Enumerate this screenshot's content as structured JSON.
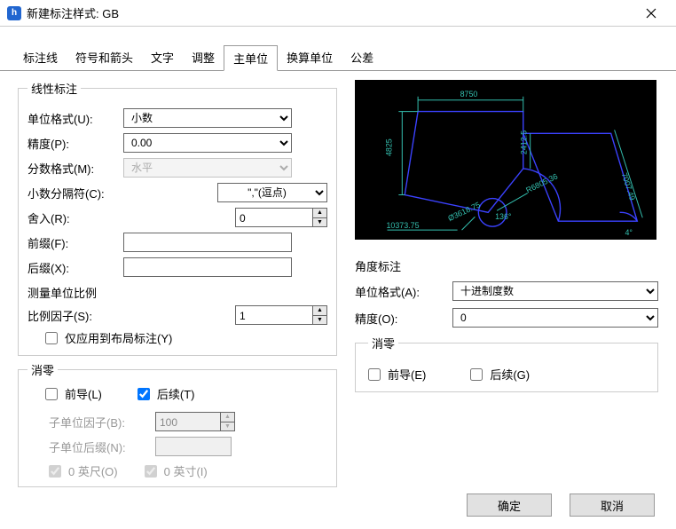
{
  "title": "新建标注样式: GB",
  "tabs": [
    "标注线",
    "符号和箭头",
    "文字",
    "调整",
    "主单位",
    "换算单位",
    "公差"
  ],
  "linear": {
    "legend": "线性标注",
    "unit_format_label": "单位格式(U):",
    "unit_format_value": "小数",
    "precision_label": "精度(P):",
    "precision_value": "0.00",
    "fraction_label": "分数格式(M):",
    "fraction_value": "水平",
    "decimal_sep_label": "小数分隔符(C):",
    "decimal_sep_value": "\",\"(逗点)",
    "round_label": "舍入(R):",
    "round_value": "0",
    "prefix_label": "前缀(F):",
    "prefix_value": "",
    "suffix_label": "后缀(X):",
    "suffix_value": ""
  },
  "scale": {
    "legend": "测量单位比例",
    "factor_label": "比例因子(S):",
    "factor_value": "1",
    "layout_only": "仅应用到布局标注(Y)"
  },
  "suppress": {
    "legend": "消零",
    "leading": "前导(L)",
    "trailing": "后续(T)",
    "subunit_factor_label": "子单位因子(B):",
    "subunit_factor_value": "100",
    "subunit_suffix_label": "子单位后缀(N):",
    "subunit_suffix_value": "",
    "feet": "0 英尺(O)",
    "inch": "0 英寸(I)"
  },
  "angle": {
    "title": "角度标注",
    "unit_label": "单位格式(A):",
    "unit_value": "十进制度数",
    "precision_label": "精度(O):",
    "precision_value": "0",
    "zero_legend": "消零",
    "leading": "前导(E)",
    "trailing": "后续(G)"
  },
  "preview": {
    "top_dim": "8750",
    "left_dim": "4825",
    "mid_dim": "2412.5",
    "bottom": "10373.75",
    "r_small": "Ø3618.75",
    "r_large": "R6805.36",
    "ang1": "136°",
    "diag": "7007.49",
    "ang2": "4°"
  },
  "footer": {
    "ok": "确定",
    "cancel": "取消"
  }
}
